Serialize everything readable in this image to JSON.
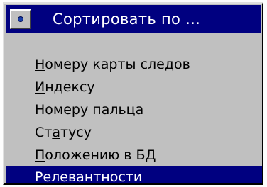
{
  "window": {
    "title": "Сортировать по ..."
  },
  "menu": {
    "items": [
      {
        "pre": "",
        "accel": "Н",
        "rest": "омеру карты следов",
        "selected": false
      },
      {
        "pre": "",
        "accel": "И",
        "rest": "ндексу",
        "selected": false
      },
      {
        "pre": "Номеру пальца",
        "accel": "",
        "rest": "",
        "selected": false
      },
      {
        "pre": "Ст",
        "accel": "а",
        "rest": "тусу",
        "selected": false
      },
      {
        "pre": "",
        "accel": "П",
        "rest": "оложению в БД",
        "selected": false
      },
      {
        "pre": "Релевантности",
        "accel": "",
        "rest": "",
        "selected": true
      }
    ]
  },
  "colors": {
    "titlebar": "#000080",
    "selection": "#000080",
    "dialog_bg": "#c0c0c0"
  },
  "icons": {
    "system_menu": "system-menu-dot-icon"
  }
}
